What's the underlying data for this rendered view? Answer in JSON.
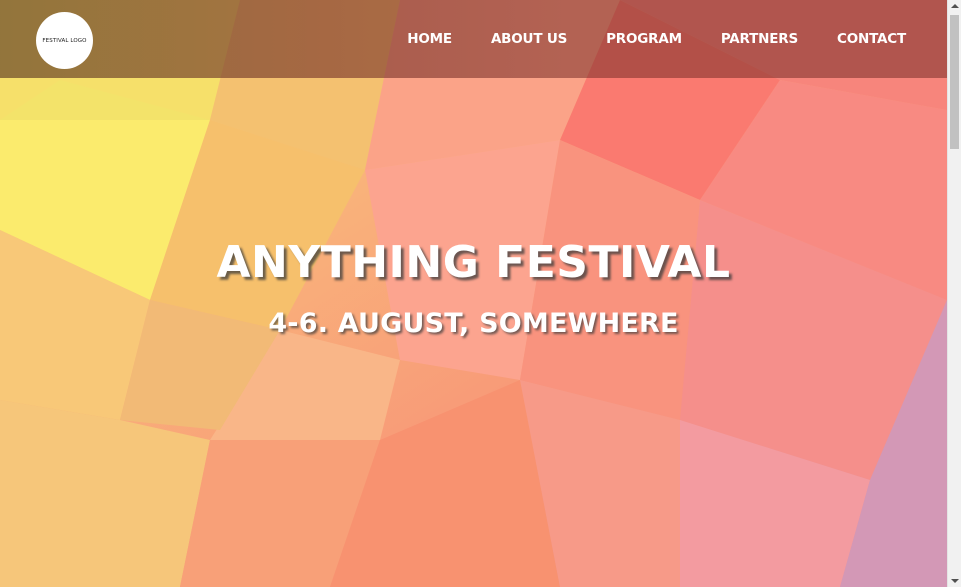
{
  "logo": {
    "text": "FESTIVAL LOGO"
  },
  "nav": {
    "items": [
      {
        "label": "HOME"
      },
      {
        "label": "ABOUT US"
      },
      {
        "label": "PROGRAM"
      },
      {
        "label": "PARTNERS"
      },
      {
        "label": "CONTACT"
      }
    ]
  },
  "hero": {
    "title": "ANYTHING FESTIVAL",
    "subtitle": "4-6. AUGUST, SOMEWHERE"
  },
  "colors": {
    "background_yellow": "#fbe36a",
    "background_orange": "#f89a72",
    "background_pink": "#f4918f",
    "background_purple": "#c793b6",
    "navbar_overlay": "#7a3a33",
    "text": "#ffffff"
  },
  "icons": {
    "scroll_up": "triangle-up-icon",
    "scroll_down": "triangle-down-icon"
  }
}
